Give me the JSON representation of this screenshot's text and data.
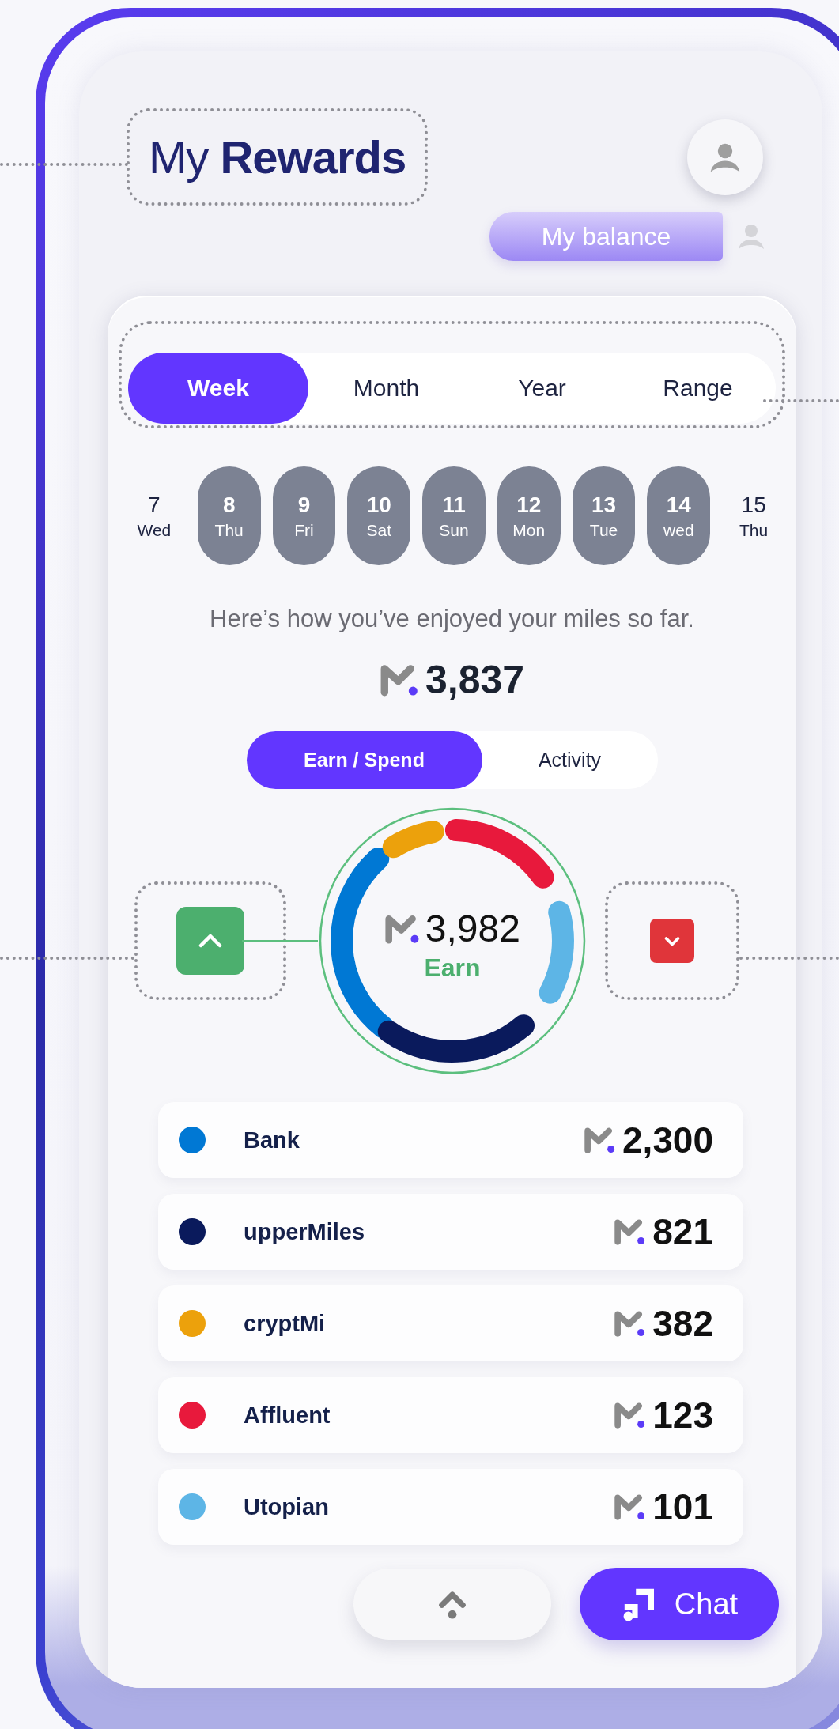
{
  "title": "My **Rewards**",
  "balance_button": {
    "label": "My balance"
  },
  "period_tabs": [
    {
      "label": "Week",
      "selected": true
    },
    {
      "label": "Month",
      "selected": false
    },
    {
      "label": "Year",
      "selected": false
    },
    {
      "label": "Range",
      "selected": false
    }
  ],
  "days": [
    {
      "number": "7",
      "weekday": "Wed",
      "selected": false
    },
    {
      "number": "8",
      "weekday": "Thu",
      "selected": true
    },
    {
      "number": "9",
      "weekday": "Fri",
      "selected": true
    },
    {
      "number": "10",
      "weekday": "Sat",
      "selected": true
    },
    {
      "number": "11",
      "weekday": "Sun",
      "selected": true
    },
    {
      "number": "12",
      "weekday": "Mon",
      "selected": true
    },
    {
      "number": "13",
      "weekday": "Tue",
      "selected": true
    },
    {
      "number": "14",
      "weekday": "wed",
      "selected": true
    },
    {
      "number": "15",
      "weekday": "Thu",
      "selected": false
    }
  ],
  "summary": {
    "text": "Here’s how you’ve enjoyed your miles so far.",
    "total": "3,837"
  },
  "view_tabs": [
    {
      "label": "Earn / Spend",
      "selected": true
    },
    {
      "label": "Activity",
      "selected": false
    }
  ],
  "donut": {
    "amount": "3,982",
    "label": "Earn"
  },
  "sources": [
    {
      "name": "Bank",
      "amount": "2,300",
      "color": "#0078d4"
    },
    {
      "name": "upperMiles",
      "amount": "821",
      "color": "#0a1a5c"
    },
    {
      "name": "cryptMi",
      "amount": "382",
      "color": "#eca10c"
    },
    {
      "name": "Affluent",
      "amount": "123",
      "color": "#e8193c"
    },
    {
      "name": "Utopian",
      "amount": "101",
      "color": "#5db5e6"
    }
  ],
  "chat_button": {
    "label": "Chat"
  }
}
